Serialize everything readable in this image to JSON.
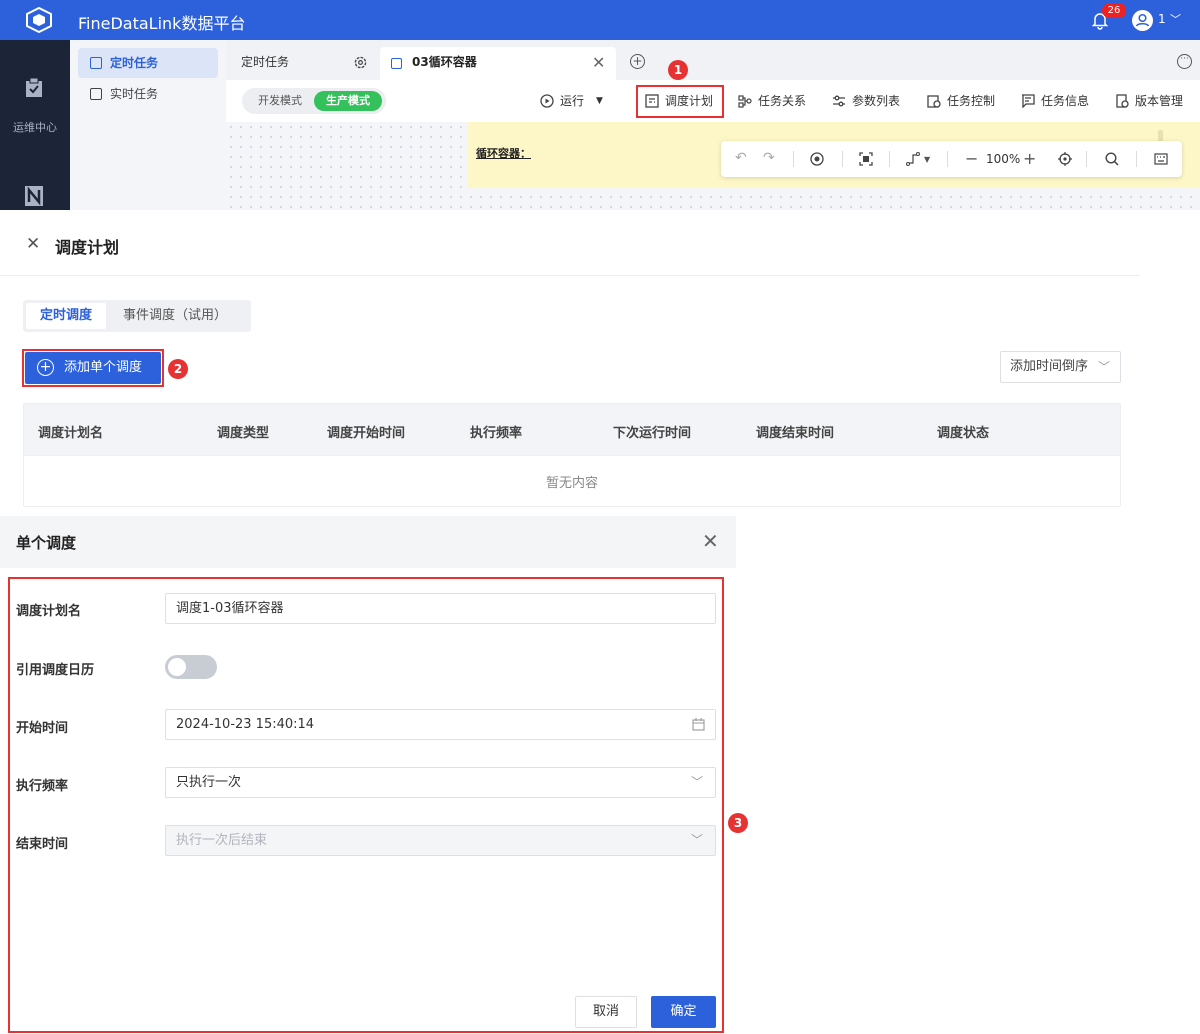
{
  "app": {
    "title": "FineDataLink数据平台",
    "notif_count": "26",
    "user_label": "1"
  },
  "leftnav": {
    "ops_label": "运维中心"
  },
  "subnav": {
    "items": [
      {
        "label": "定时任务"
      },
      {
        "label": "实时任务"
      }
    ]
  },
  "tabs": {
    "tab1": "定时任务",
    "tab2": "03循环容器"
  },
  "toolbar": {
    "dev_mode": "开发模式",
    "prod_mode": "生产模式",
    "run": "运行",
    "schedule": "调度计划",
    "task_rel": "任务关系",
    "params": "参数列表",
    "task_ctrl": "任务控制",
    "task_info": "任务信息",
    "version": "版本管理"
  },
  "canvas": {
    "note_text": "循环容器：",
    "zoom": "100%"
  },
  "annotations": {
    "n1": "1",
    "n2": "2",
    "n3": "3"
  },
  "schedule_panel": {
    "title": "调度计划",
    "tab_timed": "定时调度",
    "tab_event": "事件调度（试用）",
    "add_button": "添加单个调度",
    "sort_label": "添加时间倒序",
    "columns": [
      "调度计划名",
      "调度类型",
      "调度开始时间",
      "执行频率",
      "下次运行时间",
      "调度结束时间",
      "调度状态"
    ],
    "empty": "暂无内容"
  },
  "single_panel": {
    "title": "单个调度",
    "name_label": "调度计划名",
    "name_value": "调度1-03循环容器",
    "calendar_label": "引用调度日历",
    "start_label": "开始时间",
    "start_value": "2024-10-23 15:40:14",
    "freq_label": "执行频率",
    "freq_value": "只执行一次",
    "end_label": "结束时间",
    "end_value": "执行一次后结束",
    "cancel": "取消",
    "ok": "确定"
  }
}
